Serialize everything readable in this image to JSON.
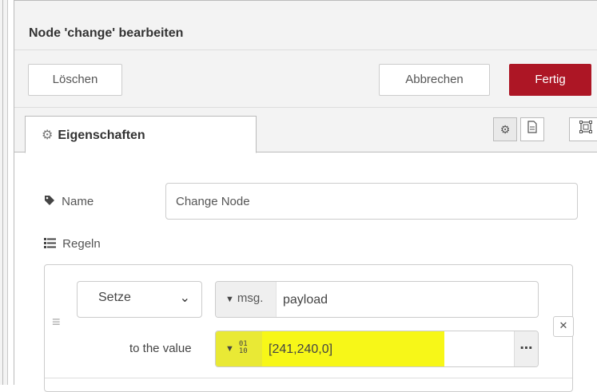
{
  "header": {
    "title": "Node 'change' bearbeiten"
  },
  "toolbar": {
    "delete_label": "Löschen",
    "cancel_label": "Abbrechen",
    "done_label": "Fertig"
  },
  "tabs": {
    "properties_label": "Eigenschaften"
  },
  "form": {
    "name_label": "Name",
    "name_value": "Change Node",
    "rules_label": "Regeln"
  },
  "rule": {
    "action": "Setze",
    "property_prefix": "msg.",
    "property_value": "payload",
    "to_value_label": "to the value",
    "value_type_icon": "01\n10",
    "value": "[241,240,0]"
  },
  "colors": {
    "done_button": "#ad1625",
    "highlight": "#f7f718"
  }
}
